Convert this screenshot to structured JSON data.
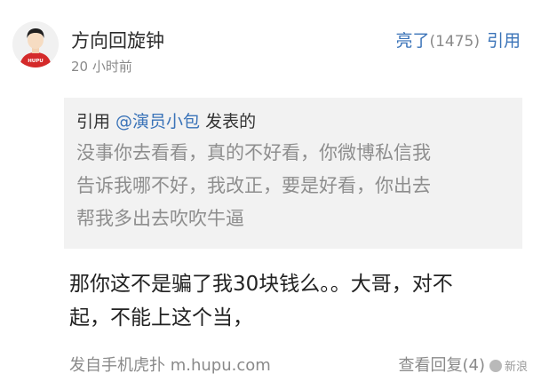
{
  "post": {
    "username": "方向回旋钟",
    "time": "20 小时前",
    "light_label": "亮了",
    "light_count": "(1475)",
    "reply_label": "引用",
    "avatar_text": "HUPU"
  },
  "quote": {
    "prefix": "引用 ",
    "mention": "@演员小包",
    "suffix": " 发表的",
    "lines": [
      "没事你去看看，真的不好看，你微博私信我",
      "告诉我哪不好，我改正，要是好看，你出去",
      "帮我多出去吹吹牛逼"
    ]
  },
  "reply": {
    "lines": [
      "那你这不是骗了我30块钱么。。大哥，对不",
      "起，不能上这个当，"
    ]
  },
  "footer": {
    "source": "发自手机虎扑 m.hupu.com",
    "view_replies": "查看回复(4)"
  },
  "watermark": {
    "text": "新浪"
  },
  "colors": {
    "link": "#3a73b8",
    "muted": "#8a8a8a",
    "quote_bg": "#f2f2f2",
    "avatar_shirt": "#d42a2a"
  }
}
